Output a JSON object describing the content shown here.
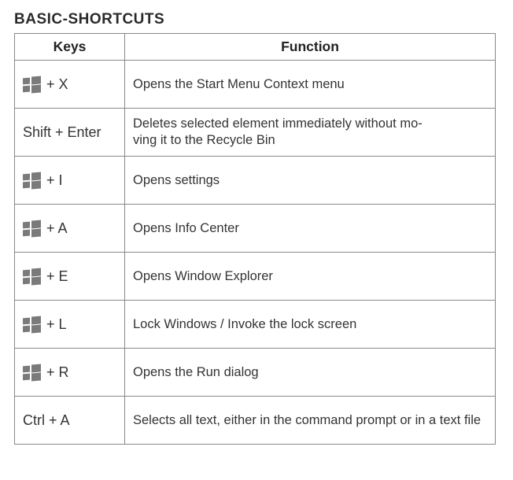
{
  "title": "BASIC-SHORTCUTS",
  "headers": {
    "keys": "Keys",
    "function": "Function"
  },
  "rows": [
    {
      "hasWinIcon": true,
      "keyText": "+ X",
      "function": "Opens the Start Menu Context menu"
    },
    {
      "hasWinIcon": false,
      "keyText": "Shift + Enter",
      "function": "Deletes selected element immediately without mo-\nving it to the Recycle Bin"
    },
    {
      "hasWinIcon": true,
      "keyText": "+ I",
      "function": "Opens settings"
    },
    {
      "hasWinIcon": true,
      "keyText": "+ A",
      "function": "Opens Info Center"
    },
    {
      "hasWinIcon": true,
      "keyText": "+ E",
      "function": "Opens Window Explorer"
    },
    {
      "hasWinIcon": true,
      "keyText": "+ L",
      "function": "Lock Windows / Invoke the lock screen"
    },
    {
      "hasWinIcon": true,
      "keyText": "+ R",
      "function": "Opens the Run dialog"
    },
    {
      "hasWinIcon": false,
      "keyText": "Ctrl + A",
      "function": "Selects all text, either in the command prompt or in a text file"
    }
  ]
}
